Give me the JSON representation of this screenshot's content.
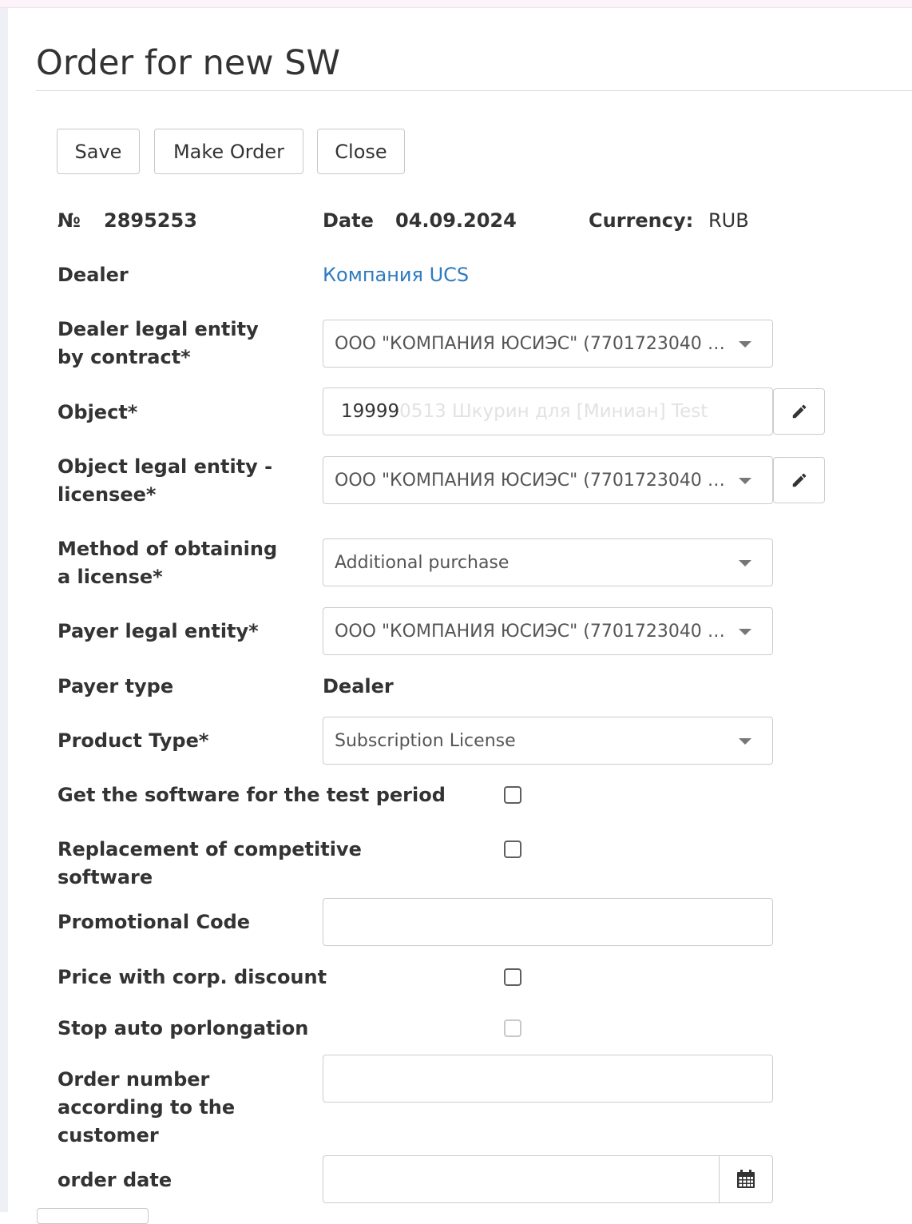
{
  "page": {
    "title": "Order for new SW"
  },
  "toolbar": {
    "save_label": "Save",
    "make_order_label": "Make Order",
    "close_label": "Close"
  },
  "header": {
    "number_label": "№",
    "number_value": "2895253",
    "date_label": "Date",
    "date_value": "04.09.2024",
    "currency_label": "Currency:",
    "currency_value": "RUB"
  },
  "form": {
    "dealer": {
      "label": "Dealer",
      "value": "Компания UCS"
    },
    "dealer_legal_entity": {
      "label_line1": "Dealer legal entity",
      "label_line2": "by contract*",
      "value": "ООО \"КОМПАНИЯ ЮСИЭС\" (7701723040 7..."
    },
    "object": {
      "label": "Object*",
      "value_visible": "19999",
      "value_faded": "0513 Шкурин для [Mиниан] Test",
      "icon": "pencil-icon"
    },
    "object_legal_entity": {
      "label_line1": "Object legal entity -",
      "label_line2": "licensee*",
      "value": "ООО \"КОМПАНИЯ ЮСИЭС\" (7701723040 7...",
      "icon": "pencil-icon"
    },
    "method": {
      "label_line1": "Method of obtaining",
      "label_line2": "a license*",
      "value": "Additional purchase"
    },
    "payer_legal_entity": {
      "label": "Payer legal entity*",
      "value": "ООО \"КОМПАНИЯ ЮСИЭС\" (7701723040 7..."
    },
    "payer_type": {
      "label": "Payer type",
      "value": "Dealer"
    },
    "product_type": {
      "label": "Product Type*",
      "value": "Subscription License"
    },
    "test_period": {
      "label": "Get the software for the test period",
      "checked": false
    },
    "replacement": {
      "label_line1": "Replacement of competitive",
      "label_line2": "software",
      "checked": false
    },
    "promo_code": {
      "label": "Promotional Code",
      "value": ""
    },
    "corp_discount": {
      "label": "Price with corp. discount",
      "checked": false
    },
    "stop_auto": {
      "label": "Stop auto porlongation",
      "checked": false,
      "disabled": true
    },
    "customer_order_number": {
      "label_line1": "Order number",
      "label_line2": "according to the",
      "label_line3": "customer",
      "value": ""
    },
    "order_date": {
      "label": "order date",
      "value": "",
      "icon": "calendar-icon"
    }
  },
  "colors": {
    "link": "#2f7bbf",
    "text": "#333333",
    "border": "#cccccc"
  }
}
